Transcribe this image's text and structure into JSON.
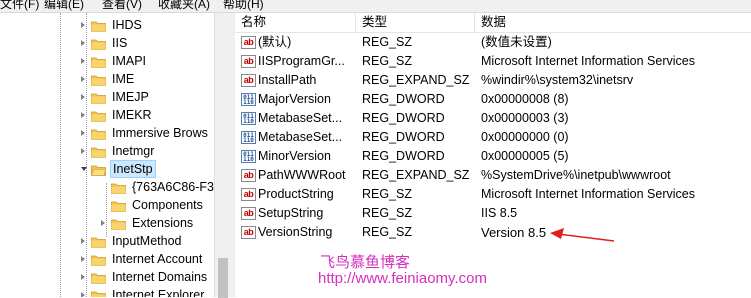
{
  "menu": [
    "文件(F)",
    "编辑(E)",
    "查看(V)",
    "收藏夹(A)",
    "帮助(H)"
  ],
  "tree": {
    "items": [
      {
        "label": "IHDS",
        "level": 0,
        "expanded": false,
        "selected": false
      },
      {
        "label": "IIS",
        "level": 0,
        "expanded": false,
        "selected": false
      },
      {
        "label": "IMAPI",
        "level": 0,
        "expanded": false,
        "selected": false
      },
      {
        "label": "IME",
        "level": 0,
        "expanded": false,
        "selected": false
      },
      {
        "label": "IMEJP",
        "level": 0,
        "expanded": false,
        "selected": false
      },
      {
        "label": "IMEKR",
        "level": 0,
        "expanded": false,
        "selected": false
      },
      {
        "label": "Immersive Brows",
        "level": 0,
        "expanded": false,
        "selected": false
      },
      {
        "label": "Inetmgr",
        "level": 0,
        "expanded": false,
        "selected": false
      },
      {
        "label": "InetStp",
        "level": 0,
        "expanded": true,
        "selected": true
      },
      {
        "label": "{763A6C86-F3",
        "level": 1,
        "expanded": false,
        "selected": false,
        "leaf": true
      },
      {
        "label": "Components",
        "level": 1,
        "expanded": false,
        "selected": false,
        "leaf": true
      },
      {
        "label": "Extensions",
        "level": 1,
        "expanded": false,
        "selected": false
      },
      {
        "label": "InputMethod",
        "level": 0,
        "expanded": false,
        "selected": false
      },
      {
        "label": "Internet Account",
        "level": 0,
        "expanded": false,
        "selected": false
      },
      {
        "label": "Internet Domains",
        "level": 0,
        "expanded": false,
        "selected": false
      },
      {
        "label": "Internet Explorer",
        "level": 0,
        "expanded": false,
        "selected": false
      }
    ]
  },
  "list": {
    "columns": [
      "名称",
      "类型",
      "数据"
    ],
    "rows": [
      {
        "icon": "string-value-icon",
        "name": "(默认)",
        "type": "REG_SZ",
        "data": "(数值未设置)"
      },
      {
        "icon": "string-value-icon",
        "name": "IISProgramGr...",
        "type": "REG_SZ",
        "data": "Microsoft Internet Information Services"
      },
      {
        "icon": "string-value-icon",
        "name": "InstallPath",
        "type": "REG_EXPAND_SZ",
        "data": "%windir%\\system32\\inetsrv"
      },
      {
        "icon": "binary-value-icon",
        "name": "MajorVersion",
        "type": "REG_DWORD",
        "data": "0x00000008 (8)"
      },
      {
        "icon": "binary-value-icon",
        "name": "MetabaseSet...",
        "type": "REG_DWORD",
        "data": "0x00000003 (3)"
      },
      {
        "icon": "binary-value-icon",
        "name": "MetabaseSet...",
        "type": "REG_DWORD",
        "data": "0x00000000 (0)"
      },
      {
        "icon": "binary-value-icon",
        "name": "MinorVersion",
        "type": "REG_DWORD",
        "data": "0x00000005 (5)"
      },
      {
        "icon": "string-value-icon",
        "name": "PathWWWRoot",
        "type": "REG_EXPAND_SZ",
        "data": "%SystemDrive%\\inetpub\\wwwroot"
      },
      {
        "icon": "string-value-icon",
        "name": "ProductString",
        "type": "REG_SZ",
        "data": "Microsoft Internet Information Services"
      },
      {
        "icon": "string-value-icon",
        "name": "SetupString",
        "type": "REG_SZ",
        "data": "IIS 8.5"
      },
      {
        "icon": "string-value-icon",
        "name": "VersionString",
        "type": "REG_SZ",
        "data": "Version 8.5"
      }
    ]
  },
  "watermark": {
    "line1": "飞鸟慕鱼博客",
    "line2": "http://www.feiniaomy.com"
  },
  "colors": {
    "selection": "#cce8ff",
    "folder": "#f6c350",
    "watermark": "#d62fbf",
    "annotation_arrow": "#e02020"
  }
}
